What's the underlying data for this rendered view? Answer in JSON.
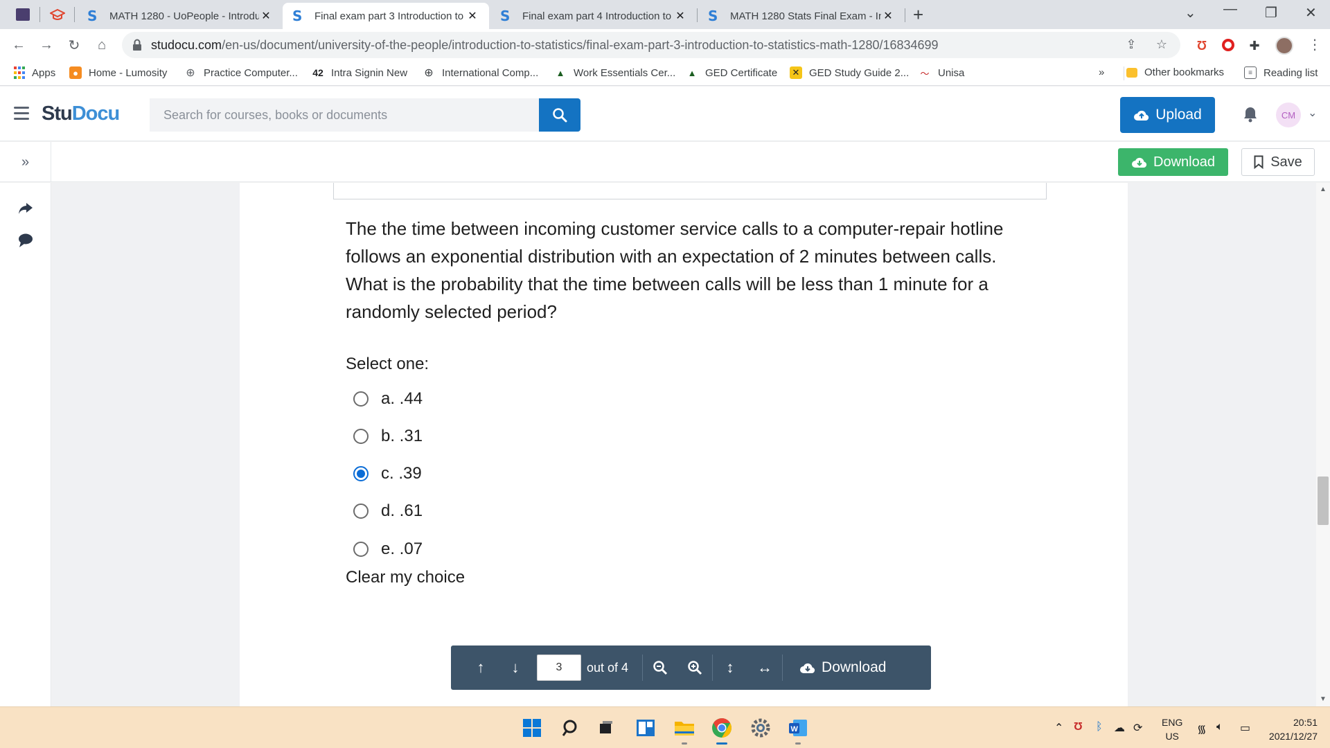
{
  "browser": {
    "tabs": [
      {
        "title": "MATH 1280 - UoPeople - Introdu",
        "active": false
      },
      {
        "title": "Final exam part 3 Introduction to",
        "active": true
      },
      {
        "title": "Final exam part 4 Introduction to",
        "active": false
      },
      {
        "title": "MATH 1280 Stats Final Exam - Int",
        "active": false
      }
    ],
    "url_domain": "studocu.com",
    "url_path": "/en-us/document/university-of-the-people/introduction-to-statistics/final-exam-part-3-introduction-to-statistics-math-1280/16834699",
    "bookmarks": [
      {
        "label": "Apps",
        "icon": "apps-grid-icon"
      },
      {
        "label": "Home - Lumosity",
        "icon": "lumosity-icon"
      },
      {
        "label": "Practice Computer...",
        "icon": "globe-icon"
      },
      {
        "label": "Intra Signin New",
        "icon": "intra-icon"
      },
      {
        "label": "International Comp...",
        "icon": "globe-icon"
      },
      {
        "label": "Work Essentials Cer...",
        "icon": "graduation-cap-icon"
      },
      {
        "label": "GED Certificate",
        "icon": "graduation-cap-icon"
      },
      {
        "label": "GED Study Guide 2...",
        "icon": "ged-icon"
      },
      {
        "label": "Unisa",
        "icon": "unisa-icon"
      }
    ],
    "bookmarks_overflow": "»",
    "other_bookmarks": "Other bookmarks",
    "reading_list": "Reading list"
  },
  "studocu": {
    "logo_part1": "Stu",
    "logo_part2": "Docu",
    "search_placeholder": "Search for courses, books or documents",
    "upload_label": "Upload",
    "avatar_initials": "CM",
    "download_label": "Download",
    "save_label": "Save"
  },
  "document": {
    "question": "The the time between incoming customer service calls to a computer-repair hotline follows an exponential distribution with an expectation of 2 minutes between calls.  What is the probability that the time between calls will be less than 1 minute for a randomly selected period?",
    "select_label": "Select one:",
    "options": [
      {
        "label": "a. .44",
        "checked": false
      },
      {
        "label": "b. .31",
        "checked": false
      },
      {
        "label": "c. .39",
        "checked": true
      },
      {
        "label": "d. .61",
        "checked": false
      },
      {
        "label": "e. .07",
        "checked": false
      }
    ],
    "clear_label": "Clear my choice"
  },
  "viewer_toolbar": {
    "current_page": "3",
    "out_of": "out of 4",
    "download_label": "Download"
  },
  "taskbar": {
    "lang_line1": "ENG",
    "lang_line2": "US",
    "time": "20:51",
    "date": "2021/12/27"
  },
  "colors": {
    "studocu_blue": "#1473c2",
    "download_green": "#3cb56b",
    "viewer_bar": "#3d5469",
    "radio_checked": "#0a6cd6",
    "taskbar": "#f9e2c4"
  }
}
